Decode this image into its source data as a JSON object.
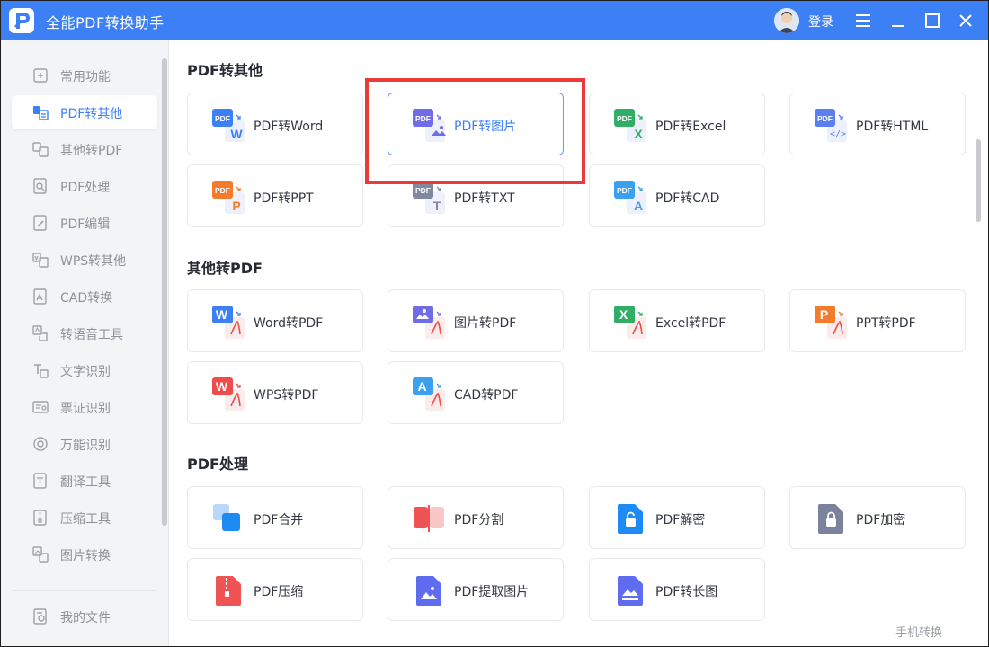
{
  "app": {
    "title": "全能PDF转换助手",
    "login_label": "登录"
  },
  "sidebar": {
    "items": [
      {
        "label": "常用功能",
        "icon": "common-functions-icon"
      },
      {
        "label": "PDF转其他",
        "icon": "pdf-to-other-icon",
        "active": true
      },
      {
        "label": "其他转PDF",
        "icon": "other-to-pdf-icon"
      },
      {
        "label": "PDF处理",
        "icon": "pdf-process-icon"
      },
      {
        "label": "PDF编辑",
        "icon": "pdf-edit-icon"
      },
      {
        "label": "WPS转其他",
        "icon": "wps-convert-icon"
      },
      {
        "label": "CAD转换",
        "icon": "cad-convert-icon"
      },
      {
        "label": "转语音工具",
        "icon": "text-to-speech-icon"
      },
      {
        "label": "文字识别",
        "icon": "text-recognition-icon"
      },
      {
        "label": "票证识别",
        "icon": "ticket-recognition-icon"
      },
      {
        "label": "万能识别",
        "icon": "universal-recognition-icon"
      },
      {
        "label": "翻译工具",
        "icon": "translate-icon"
      },
      {
        "label": "压缩工具",
        "icon": "compress-icon"
      },
      {
        "label": "图片转换",
        "icon": "image-convert-icon"
      }
    ],
    "my_files": "我的文件"
  },
  "sections": [
    {
      "title": "PDF转其他",
      "cards": [
        {
          "label": "PDF转Word",
          "icon": "pdf-to-word-icon",
          "accent": "#3d80f6",
          "badge": "W"
        },
        {
          "label": "PDF转图片",
          "icon": "pdf-to-image-icon",
          "accent": "#6f6ee8",
          "badge": "img",
          "selected": true
        },
        {
          "label": "PDF转Excel",
          "icon": "pdf-to-excel-icon",
          "accent": "#2fae64",
          "badge": "X"
        },
        {
          "label": "PDF转HTML",
          "icon": "pdf-to-html-icon",
          "accent": "#5a7ff0",
          "badge": "</>"
        },
        {
          "label": "PDF转PPT",
          "icon": "pdf-to-ppt-icon",
          "accent": "#f47b2c",
          "badge": "P"
        },
        {
          "label": "PDF转TXT",
          "icon": "pdf-to-txt-icon",
          "accent": "#8189a0",
          "badge": "T"
        },
        {
          "label": "PDF转CAD",
          "icon": "pdf-to-cad-icon",
          "accent": "#3aa0f0",
          "badge": "A"
        }
      ]
    },
    {
      "title": "其他转PDF",
      "cards": [
        {
          "label": "Word转PDF",
          "icon": "word-to-pdf-icon",
          "accent": "#3d80f6",
          "badge": "W"
        },
        {
          "label": "图片转PDF",
          "icon": "image-to-pdf-icon",
          "accent": "#6f6ee8",
          "badge": "img"
        },
        {
          "label": "Excel转PDF",
          "icon": "excel-to-pdf-icon",
          "accent": "#2fae64",
          "badge": "X"
        },
        {
          "label": "PPT转PDF",
          "icon": "ppt-to-pdf-icon",
          "accent": "#f47b2c",
          "badge": "P"
        },
        {
          "label": "WPS转PDF",
          "icon": "wps-to-pdf-icon",
          "accent": "#ef4b4b",
          "badge": "W"
        },
        {
          "label": "CAD转PDF",
          "icon": "cad-to-pdf-icon",
          "accent": "#3aa0f0",
          "badge": "A"
        }
      ]
    },
    {
      "title": "PDF处理",
      "cards": [
        {
          "label": "PDF合并",
          "icon": "pdf-merge-icon",
          "accent": "#1e8bf5"
        },
        {
          "label": "PDF分割",
          "icon": "pdf-split-icon",
          "accent": "#f05353"
        },
        {
          "label": "PDF解密",
          "icon": "pdf-decrypt-icon",
          "accent": "#1e8bf5"
        },
        {
          "label": "PDF加密",
          "icon": "pdf-encrypt-icon",
          "accent": "#7a829e"
        },
        {
          "label": "PDF压缩",
          "icon": "pdf-compress-icon",
          "accent": "#f05353"
        },
        {
          "label": "PDF提取图片",
          "icon": "pdf-extract-image-icon",
          "accent": "#5f6cf0"
        },
        {
          "label": "PDF转长图",
          "icon": "pdf-long-image-icon",
          "accent": "#5f6cf0"
        }
      ]
    }
  ],
  "footer": {
    "phone_convert": "手机转换"
  },
  "colors": {
    "brand": "#3d80f6",
    "highlight": "#ea3a3a"
  }
}
